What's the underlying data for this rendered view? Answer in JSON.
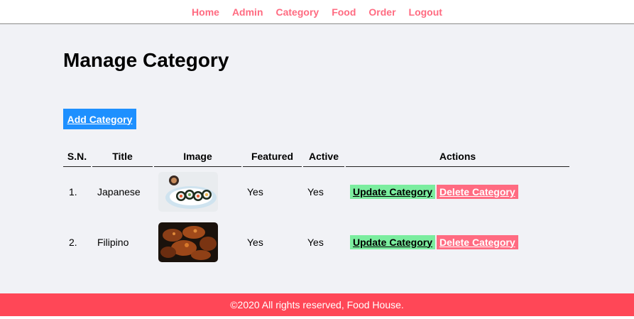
{
  "nav": {
    "items": [
      "Home",
      "Admin",
      "Category",
      "Food",
      "Order",
      "Logout"
    ]
  },
  "page": {
    "title": "Manage Category",
    "add_button": "Add Category"
  },
  "table": {
    "headers": [
      "S.N.",
      "Title",
      "Image",
      "Featured",
      "Active",
      "Actions"
    ],
    "rows": [
      {
        "sn": "1.",
        "title": "Japanese",
        "image": "sushi-rolls-image",
        "featured": "Yes",
        "active": "Yes",
        "update": "Update Category",
        "delete": "Delete Category"
      },
      {
        "sn": "2.",
        "title": "Filipino",
        "image": "chicken-adobo-image",
        "featured": "Yes",
        "active": "Yes",
        "update": "Update Category",
        "delete": "Delete Category"
      }
    ]
  },
  "footer": {
    "text": "©2020 All rights reserved, Food House."
  },
  "colors": {
    "nav_link": "#ff6b81",
    "primary_button": "#1e90ff",
    "secondary_button": "#7bed9f",
    "danger_button": "#ff6b81",
    "footer_bg": "#ff4757",
    "content_bg": "#f1f2f6"
  }
}
